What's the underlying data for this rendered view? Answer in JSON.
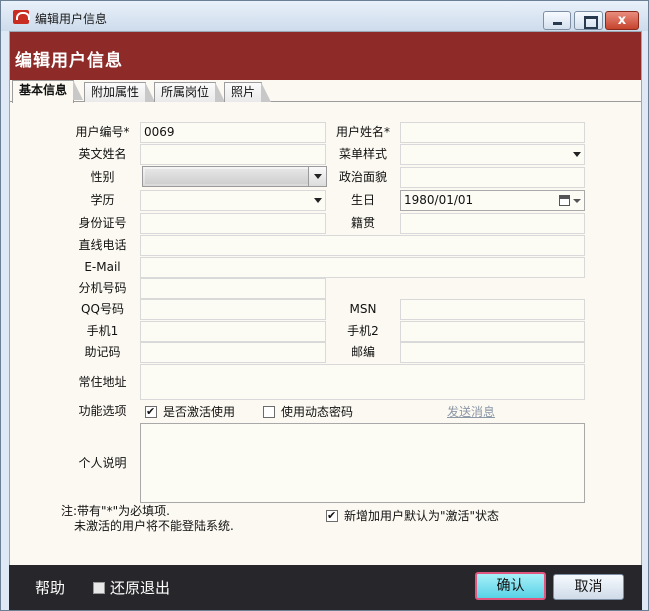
{
  "window": {
    "title": "编辑用户信息",
    "close_label": "x"
  },
  "header": {
    "title": "编辑用户信息"
  },
  "tabs": [
    {
      "label": "基本信息",
      "active": true
    },
    {
      "label": "附加属性",
      "active": false
    },
    {
      "label": "所属岗位",
      "active": false
    },
    {
      "label": "照片",
      "active": false
    }
  ],
  "form": {
    "user_no": {
      "label": "用户编号*",
      "value": "0069"
    },
    "user_name": {
      "label": "用户姓名*",
      "value": ""
    },
    "english_name": {
      "label": "英文姓名",
      "value": ""
    },
    "menu_style": {
      "label": "菜单样式",
      "value": ""
    },
    "gender": {
      "label": "性别",
      "value": ""
    },
    "political": {
      "label": "政治面貌",
      "value": ""
    },
    "education": {
      "label": "学历",
      "value": ""
    },
    "birthday": {
      "label": "生日",
      "value": "1980/01/01"
    },
    "id_no": {
      "label": "身份证号",
      "value": ""
    },
    "native_place": {
      "label": "籍贯",
      "value": ""
    },
    "direct_phone": {
      "label": "直线电话",
      "value": ""
    },
    "email": {
      "label": "E-Mail",
      "value": ""
    },
    "extension": {
      "label": "分机号码",
      "value": ""
    },
    "qq": {
      "label": "QQ号码",
      "value": ""
    },
    "msn": {
      "label": "MSN",
      "value": ""
    },
    "mobile1": {
      "label": "手机1",
      "value": ""
    },
    "mobile2": {
      "label": "手机2",
      "value": ""
    },
    "mnemonic": {
      "label": "助记码",
      "value": ""
    },
    "postcode": {
      "label": "邮编",
      "value": ""
    },
    "address": {
      "label": "常住地址",
      "value": ""
    },
    "options": {
      "label": "功能选项",
      "activate": {
        "label": "是否激活使用",
        "checked": true
      },
      "dynamic_password": {
        "label": "使用动态密码",
        "checked": false
      },
      "send_message": "发送消息"
    },
    "description": {
      "label": "个人说明",
      "value": ""
    }
  },
  "notes": {
    "line1": "注:带有\"*\"为必填项.",
    "line2": "未激活的用户将不能登陆系统."
  },
  "default_activate": {
    "label": "新增加用户默认为\"激活\"状态",
    "checked": true
  },
  "footer": {
    "help": "帮助",
    "restore_exit": "还原退出",
    "ok": "确认",
    "cancel": "取消"
  }
}
